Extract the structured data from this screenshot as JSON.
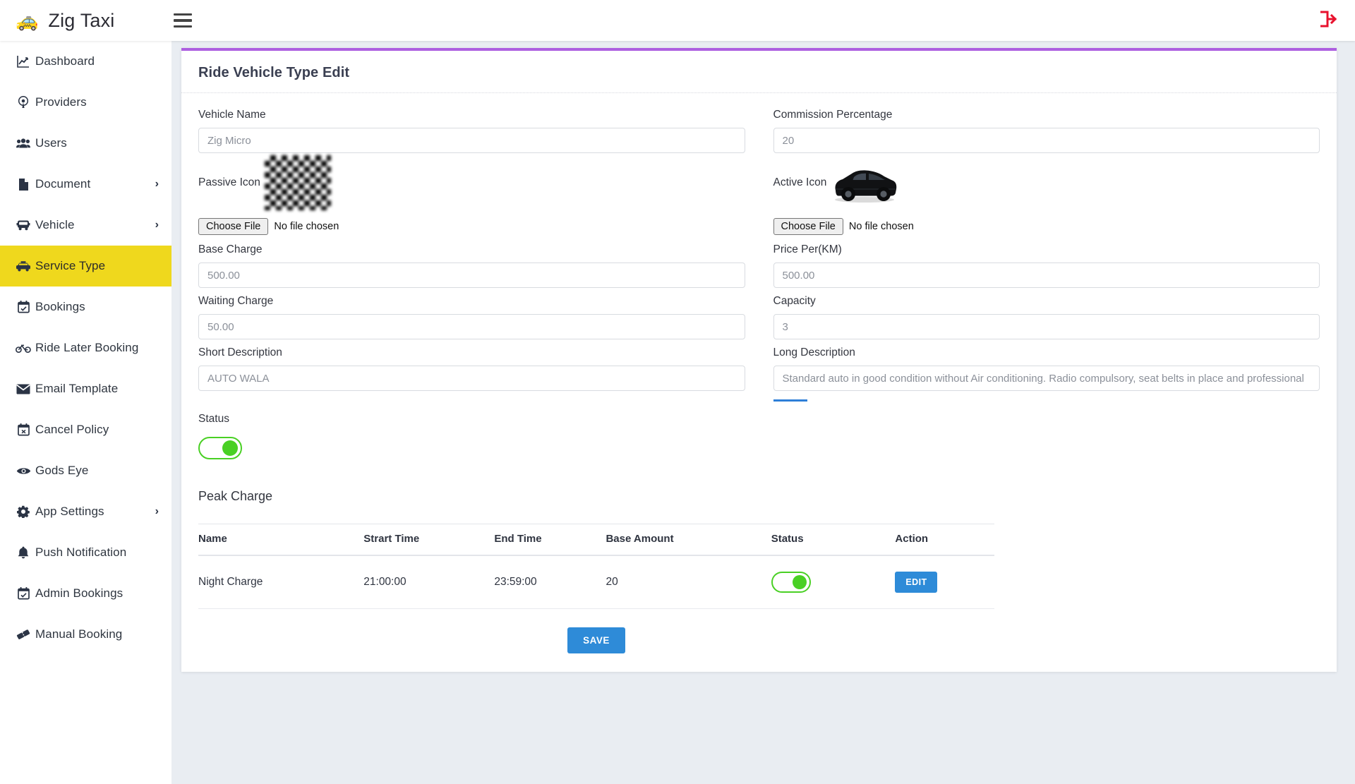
{
  "topbar": {
    "brand_icon": "taxi-icon",
    "brand_title": "Zig Taxi",
    "menu_toggle_icon": "hamburger-icon",
    "logout_icon": "logout-icon"
  },
  "sidebar": {
    "items": [
      {
        "label": "Dashboard",
        "icon": "chart-line-icon",
        "has_caret": false,
        "active": false
      },
      {
        "label": "Providers",
        "icon": "broadcast-icon",
        "has_caret": false,
        "active": false
      },
      {
        "label": "Users",
        "icon": "users-icon",
        "has_caret": false,
        "active": false
      },
      {
        "label": "Document",
        "icon": "file-icon",
        "has_caret": true,
        "active": false
      },
      {
        "label": "Vehicle",
        "icon": "bus-icon",
        "has_caret": true,
        "active": false
      },
      {
        "label": "Service Type",
        "icon": "taxi-icon",
        "has_caret": false,
        "active": true
      },
      {
        "label": "Bookings",
        "icon": "calendar-check-icon",
        "has_caret": false,
        "active": false
      },
      {
        "label": "Ride Later Booking",
        "icon": "bicycle-icon",
        "has_caret": false,
        "active": false
      },
      {
        "label": "Email Template",
        "icon": "envelope-icon",
        "has_caret": false,
        "active": false
      },
      {
        "label": "Cancel Policy",
        "icon": "calendar-times-icon",
        "has_caret": false,
        "active": false
      },
      {
        "label": "Gods Eye",
        "icon": "eye-icon",
        "has_caret": false,
        "active": false
      },
      {
        "label": "App Settings",
        "icon": "gear-icon",
        "has_caret": true,
        "active": false
      },
      {
        "label": "Push Notification",
        "icon": "bell-icon",
        "has_caret": false,
        "active": false
      },
      {
        "label": "Admin Bookings",
        "icon": "calendar-check-icon",
        "has_caret": false,
        "active": false
      },
      {
        "label": "Manual Booking",
        "icon": "ticket-icon",
        "has_caret": false,
        "active": false
      }
    ]
  },
  "page": {
    "title": "Ride Vehicle Type Edit",
    "accent_color": "#ad5fe0"
  },
  "form": {
    "vehicle_name": {
      "label": "Vehicle Name",
      "value": "Zig Micro"
    },
    "commission_percentage": {
      "label": "Commission Percentage",
      "value": "20"
    },
    "passive_icon": {
      "label": "Passive Icon",
      "preview": "checkerboard-transparent-image",
      "choose_file_label": "Choose File",
      "file_status": "No file chosen"
    },
    "active_icon": {
      "label": "Active Icon",
      "preview": "black-sedan-car-image",
      "choose_file_label": "Choose File",
      "file_status": "No file chosen"
    },
    "base_charge": {
      "label": "Base Charge",
      "value": "500.00"
    },
    "price_per_km": {
      "label": "Price Per(KM)",
      "value": "500.00"
    },
    "waiting_charge": {
      "label": "Waiting Charge",
      "value": "50.00"
    },
    "capacity": {
      "label": "Capacity",
      "value": "3"
    },
    "short_description": {
      "label": "Short Description",
      "value": "AUTO WALA"
    },
    "long_description": {
      "label": "Long Description",
      "value": "Standard auto in good condition without Air conditioning. Radio compulsory, seat belts in place and professional"
    },
    "status": {
      "label": "Status",
      "on": true,
      "accent": "#49d024"
    }
  },
  "peak_charge": {
    "section_title": "Peak Charge",
    "columns": [
      "Name",
      "Strart Time",
      "End Time",
      "Base Amount",
      "Status",
      "Action"
    ],
    "rows": [
      {
        "name": "Night Charge",
        "start_time": "21:00:00",
        "end_time": "23:59:00",
        "base_amount": "20",
        "status_on": true,
        "action_label": "EDIT"
      }
    ]
  },
  "actions": {
    "save_label": "SAVE",
    "primary_color": "#2e8bd8"
  }
}
